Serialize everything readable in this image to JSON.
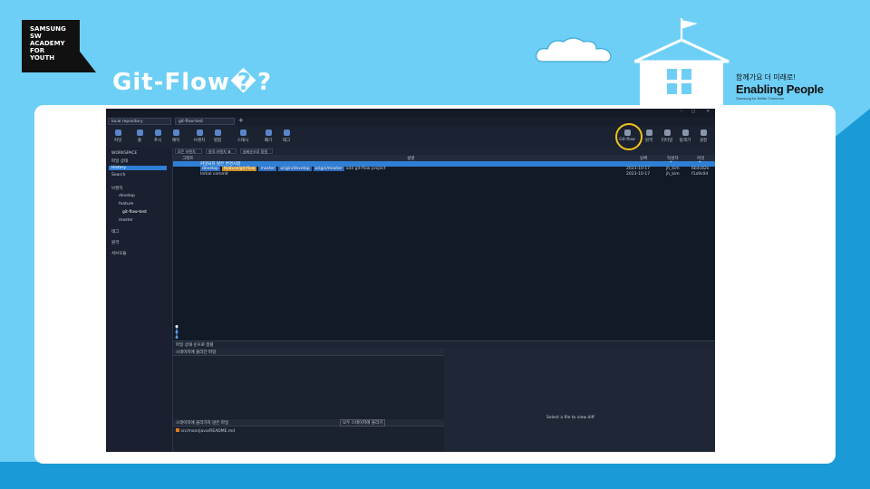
{
  "slide": {
    "logo_lines": "SAMSUNG\nSW\nACADEMY\nFOR\nYOUTH",
    "title": "Git-Flow�?",
    "brand_korean": "함께가요 더 미래로!",
    "brand_enabling": "Enabling People",
    "brand_small": "Samsung for Better Tomorrow"
  },
  "app": {
    "tabs": [
      "local repository",
      "git-flow-test"
    ],
    "toolbar_left": [
      "커밋",
      "풀",
      "푸시",
      "패치",
      "브랜치",
      "병합",
      "스태시",
      "폐기",
      "태그"
    ],
    "toolbar_right": [
      "Git-flow",
      "원격",
      "터미널",
      "탐색기",
      "설정"
    ],
    "sidebar": [
      {
        "label": "WORKSPACE",
        "selected": false
      },
      {
        "label": "파일 상태",
        "selected": false
      },
      {
        "label": "History",
        "selected": true
      },
      {
        "label": "Search",
        "selected": false
      },
      {
        "label": "브랜치",
        "selected": false
      },
      {
        "label": "develop",
        "selected": false
      },
      {
        "label": "feature",
        "selected": false
      },
      {
        "label": "git-flow-test",
        "selected": false
      },
      {
        "label": "master",
        "selected": false
      },
      {
        "label": "태그",
        "selected": false
      },
      {
        "label": "원격",
        "selected": false
      },
      {
        "label": "서브모듈",
        "selected": false
      }
    ],
    "filter_items": [
      "모든 브랜치",
      "원격 브랜치 표시",
      "날짜순으로 정렬"
    ],
    "column_headers": [
      "그래프",
      "설명",
      "날짜",
      "작성자",
      "커밋"
    ],
    "rows": [
      {
        "desc": "커밋되지 않은 변경사항",
        "date": "",
        "author": "*",
        "commit": "*",
        "selected": true
      },
      {
        "desc": "add git-flow project",
        "date": "2023-10-17",
        "author": "jh_kim",
        "commit": "6b4c82e",
        "branches": [
          "develop",
          "feature/git-flow",
          "master",
          "origin/develop",
          "origin/master"
        ],
        "selected": false
      },
      {
        "desc": "Initial commit",
        "date": "2023-10-17",
        "author": "jh_kim",
        "commit": "f1a9c0d",
        "selected": false
      }
    ],
    "bottom_left_label": "파일 상태 순으로 정렬",
    "panel_staged": "스테이지에 올라간 파일",
    "panel_unstaged": "스테이지에 올라가지 않은 파일",
    "unstaged_file": "src/main/java/README.md",
    "select_button": "모두 스테이지에 올리기",
    "diff_placeholder": "Select a file to view diff",
    "highlight_target": "Git-flow"
  }
}
